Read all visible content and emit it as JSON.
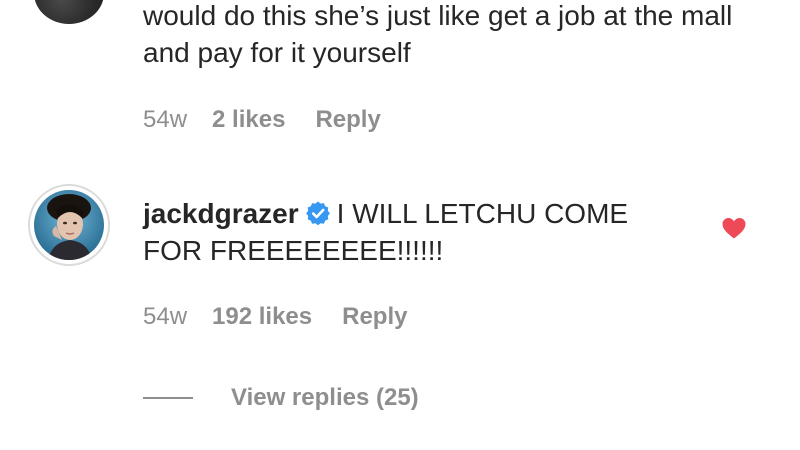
{
  "previous_comment": {
    "text": "would do this she’s just like get a job at the mall and pay for it yourself",
    "age": "54w",
    "likes": "2 likes",
    "reply_label": "Reply"
  },
  "comment": {
    "username": "jackdgrazer",
    "verified": true,
    "text": "I WILL LETCHU COME FOR FREEEEEEEE!!!!!!",
    "age": "54w",
    "likes": "192 likes",
    "reply_label": "Reply",
    "liked_by_author": true
  },
  "view_replies": {
    "label": "View replies (25)"
  },
  "colors": {
    "text": "#262626",
    "meta": "#8e8e8e",
    "verified_blue": "#3897f0",
    "heart_red": "#ed4956"
  },
  "icons": {
    "verified": "verified-badge-icon",
    "heart": "heart-icon"
  }
}
